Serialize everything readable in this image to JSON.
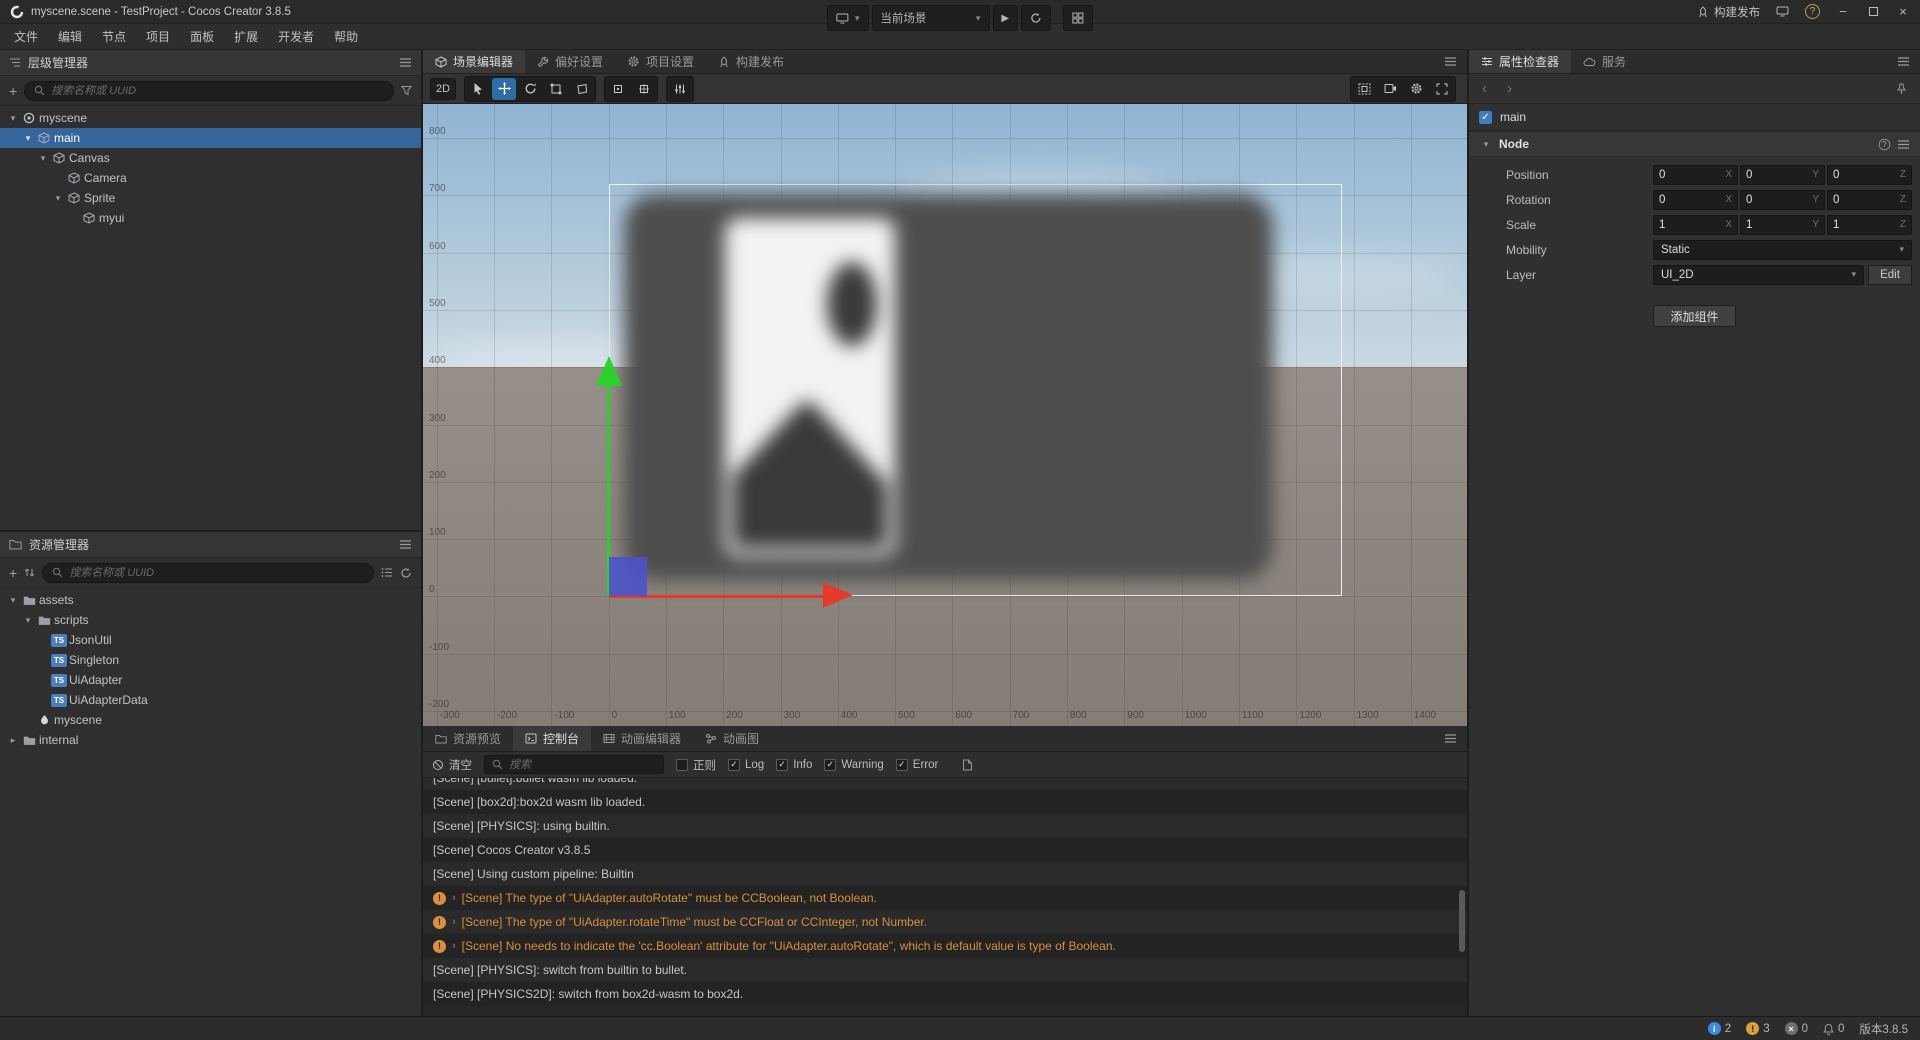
{
  "window": {
    "title": "myscene.scene - TestProject - Cocos Creator 3.8.5",
    "build_label": "构建发布",
    "help_label": "?"
  },
  "menu": {
    "items": [
      "文件",
      "编辑",
      "节点",
      "项目",
      "面板",
      "扩展",
      "开发者",
      "帮助"
    ]
  },
  "playbar": {
    "scene_select_value": "当前场景"
  },
  "hierarchy": {
    "title": "层级管理器",
    "search_placeholder": "搜索名称或 UUID",
    "items": [
      {
        "label": "myscene",
        "depth": 0,
        "icon": "scenenode",
        "children": true,
        "expanded": true
      },
      {
        "label": "main",
        "depth": 1,
        "icon": "cube",
        "children": true,
        "expanded": true,
        "selected": true
      },
      {
        "label": "Canvas",
        "depth": 2,
        "icon": "cube",
        "children": true,
        "expanded": true
      },
      {
        "label": "Camera",
        "depth": 3,
        "icon": "cube",
        "children": false
      },
      {
        "label": "Sprite",
        "depth": 3,
        "icon": "cube",
        "children": true,
        "expanded": true
      },
      {
        "label": "myui",
        "depth": 4,
        "icon": "cube",
        "children": false
      }
    ]
  },
  "assets": {
    "title": "资源管理器",
    "search_placeholder": "搜索名称或 UUID",
    "items": [
      {
        "label": "assets",
        "depth": 0,
        "icon": "folder",
        "children": true,
        "expanded": true
      },
      {
        "label": "scripts",
        "depth": 1,
        "icon": "folder",
        "children": true,
        "expanded": true
      },
      {
        "label": "JsonUtil",
        "depth": 2,
        "icon": "ts",
        "children": false
      },
      {
        "label": "Singleton",
        "depth": 2,
        "icon": "ts",
        "children": false
      },
      {
        "label": "UiAdapter",
        "depth": 2,
        "icon": "ts",
        "children": false
      },
      {
        "label": "UiAdapterData",
        "depth": 2,
        "icon": "ts",
        "children": false
      },
      {
        "label": "myscene",
        "depth": 1,
        "icon": "scenefile",
        "children": false
      },
      {
        "label": "internal",
        "depth": 0,
        "icon": "folder",
        "children": true,
        "expanded": false
      }
    ]
  },
  "editor_tabs": {
    "scene": "场景编辑器",
    "preferences": "偏好设置",
    "project": "项目设置",
    "build": "构建发布"
  },
  "scene_toolbar": {
    "mode_2d": "2D"
  },
  "scene": {
    "ruler_left": [
      "800",
      "700",
      "600",
      "500",
      "400",
      "300",
      "200",
      "100",
      "0",
      "-100",
      "-200"
    ],
    "ruler_bottom": [
      "-300",
      "-200",
      "-100",
      "0",
      "100",
      "200",
      "300",
      "400",
      "500",
      "600",
      "700",
      "800",
      "900",
      "1000",
      "1100",
      "1200",
      "1300",
      "1400"
    ]
  },
  "bottom_tabs": {
    "preview": "资源预览",
    "console": "控制台",
    "anim_editor": "动画编辑器",
    "anim_graph": "动画图"
  },
  "console": {
    "clear_label": "清空",
    "search_placeholder": "搜索",
    "filters": [
      {
        "label": "正则",
        "checked": false
      },
      {
        "label": "Log",
        "checked": true
      },
      {
        "label": "Info",
        "checked": true
      },
      {
        "label": "Warning",
        "checked": true
      },
      {
        "label": "Error",
        "checked": true
      }
    ],
    "logs": [
      {
        "text": "[Scene] [bullet]:bullet wasm lib loaded.",
        "type": "log",
        "clipped": true
      },
      {
        "text": "[Scene] [box2d]:box2d wasm lib loaded.",
        "type": "log"
      },
      {
        "text": "[Scene] [PHYSICS]: using builtin.",
        "type": "log"
      },
      {
        "text": "[Scene] Cocos Creator v3.8.5",
        "type": "log"
      },
      {
        "text": "[Scene] Using custom pipeline: Builtin",
        "type": "log"
      },
      {
        "text": "[Scene] The type of \"UiAdapter.autoRotate\" must be CCBoolean, not Boolean.",
        "type": "warning"
      },
      {
        "text": "[Scene] The type of \"UiAdapter.rotateTime\" must be CCFloat or CCInteger, not Number.",
        "type": "warning"
      },
      {
        "text": "[Scene] No needs to indicate the 'cc.Boolean' attribute for \"UiAdapter.autoRotate\", which is default value is type of Boolean.",
        "type": "warning"
      },
      {
        "text": "[Scene] [PHYSICS]: switch from builtin to bullet.",
        "type": "log"
      },
      {
        "text": "[Scene] [PHYSICS2D]: switch from box2d-wasm to box2d.",
        "type": "log"
      }
    ]
  },
  "inspector": {
    "tab_inspector": "属性检查器",
    "tab_service": "服务",
    "node_name": "main",
    "section": "Node",
    "axes": [
      "X",
      "Y",
      "Z"
    ],
    "vec3_rows": [
      {
        "label": "Position",
        "x": "0",
        "y": "0",
        "z": "0"
      },
      {
        "label": "Rotation",
        "x": "0",
        "y": "0",
        "z": "0"
      },
      {
        "label": "Scale",
        "x": "1",
        "y": "1",
        "z": "1"
      }
    ],
    "mobility_label": "Mobility",
    "mobility_value": "Static",
    "layer_label": "Layer",
    "layer_value": "UI_2D",
    "layer_edit": "Edit",
    "add_component": "添加组件"
  },
  "statusbar": {
    "info_count": "2",
    "warning_count": "3",
    "error_count": "0",
    "bell_count": "0",
    "version": "版本3.8.5"
  },
  "colors": {
    "selection": "#36659c",
    "warning_text": "#d8913f",
    "ts_badge": "#4a7fc0",
    "gizmo_green": "#2bd12b",
    "gizmo_red": "#e23b2e",
    "gizmo_blue": "#4a52cc",
    "tool_active": "#2e6da4"
  }
}
